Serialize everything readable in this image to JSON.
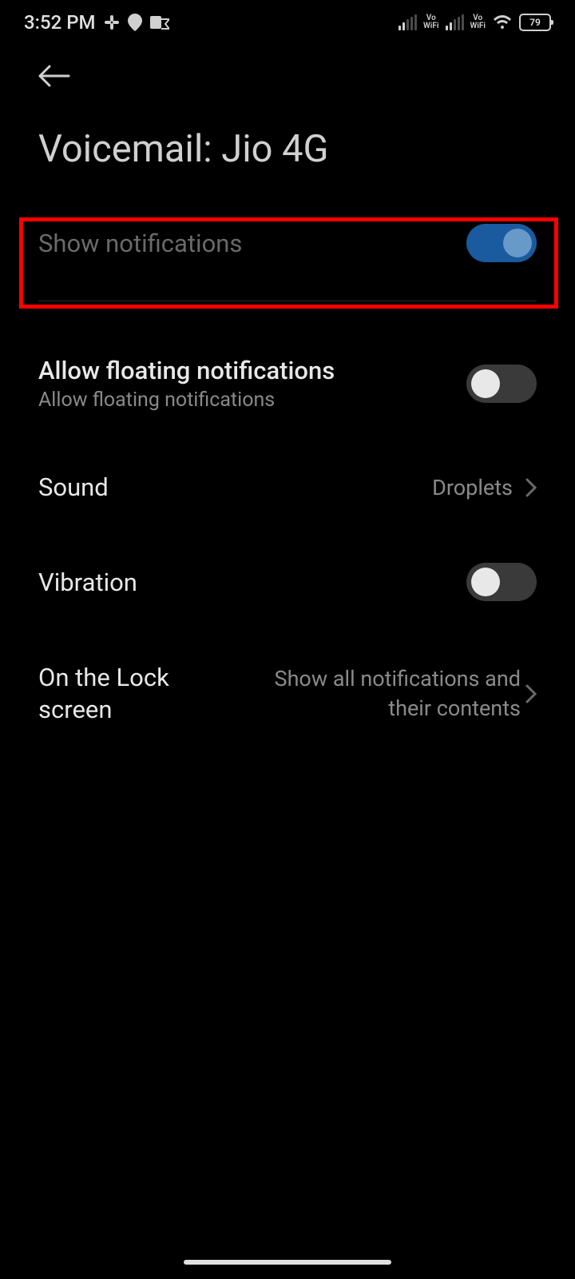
{
  "statusbar": {
    "time": "3:52 PM",
    "battery": "79",
    "vowifi": "Vo",
    "wifi_sub": "WiFi"
  },
  "header": {
    "title": "Voicemail: Jio 4G"
  },
  "settings": {
    "show_notifications": {
      "label": "Show notifications",
      "enabled": true
    },
    "floating": {
      "label": "Allow floating notifications",
      "sublabel": "Allow floating notifications",
      "enabled": false
    },
    "sound": {
      "label": "Sound",
      "value": "Droplets"
    },
    "vibration": {
      "label": "Vibration",
      "enabled": false
    },
    "lockscreen": {
      "label": "On the Lock screen",
      "value": "Show all notifications and their contents"
    }
  }
}
